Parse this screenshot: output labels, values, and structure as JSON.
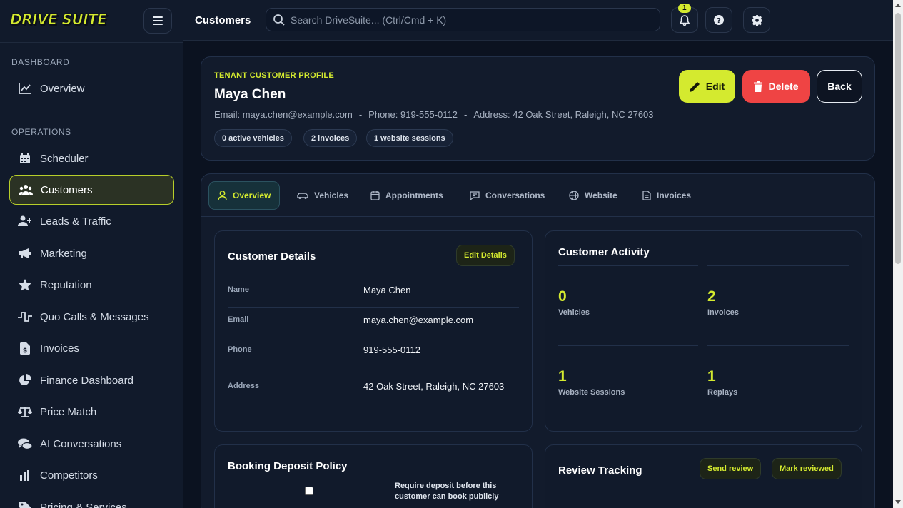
{
  "app": {
    "brand": "DRIVE SUITE"
  },
  "sidebar": {
    "sections": [
      {
        "label": "DASHBOARD"
      },
      {
        "label": "OPERATIONS"
      }
    ],
    "items": [
      {
        "label": "Overview",
        "icon": "chart-line-icon"
      },
      {
        "label": "Scheduler",
        "icon": "calendar-icon"
      },
      {
        "label": "Customers",
        "icon": "users-icon",
        "active": true
      },
      {
        "label": "Leads & Traffic",
        "icon": "user-plus-icon"
      },
      {
        "label": "Marketing",
        "icon": "megaphone-icon"
      },
      {
        "label": "Reputation",
        "icon": "star-icon"
      },
      {
        "label": "Quo Calls & Messages",
        "icon": "pulse-icon"
      },
      {
        "label": "Invoices",
        "icon": "invoice-icon"
      },
      {
        "label": "Finance Dashboard",
        "icon": "pie-chart-icon"
      },
      {
        "label": "Price Match",
        "icon": "scale-icon"
      },
      {
        "label": "AI Conversations",
        "icon": "chat-bubbles-icon"
      },
      {
        "label": "Competitors",
        "icon": "bar-chart-icon"
      },
      {
        "label": "Pricing & Services",
        "icon": "tag-icon"
      }
    ]
  },
  "topbar": {
    "title": "Customers",
    "search_placeholder": "Search DriveSuite... (Ctrl/Cmd + K)",
    "notification_count": "1"
  },
  "profile": {
    "eyebrow": "TENANT CUSTOMER PROFILE",
    "name": "Maya Chen",
    "email_text": "Email: maya.chen@example.com",
    "separator": "-",
    "phone_text": "Phone: 919-555-0112",
    "address_text": "Address: 42 Oak Street, Raleigh, NC 27603",
    "pills": [
      "0 active vehicles",
      "2 invoices",
      "1 website sessions"
    ],
    "edit_label": "Edit",
    "delete_label": "Delete",
    "back_label": "Back"
  },
  "tabs": [
    {
      "label": "Overview",
      "active": true
    },
    {
      "label": "Vehicles"
    },
    {
      "label": "Appointments"
    },
    {
      "label": "Conversations"
    },
    {
      "label": "Website"
    },
    {
      "label": "Invoices"
    }
  ],
  "customer_details": {
    "title": "Customer Details",
    "edit_label": "Edit Details",
    "rows": [
      {
        "label": "Name",
        "value": "Maya Chen"
      },
      {
        "label": "Email",
        "value": "maya.chen@example.com"
      },
      {
        "label": "Phone",
        "value": "919-555-0112"
      },
      {
        "label": "Address",
        "value": "42 Oak Street, Raleigh, NC 27603"
      }
    ]
  },
  "customer_activity": {
    "title": "Customer Activity",
    "stats": [
      {
        "value": "0",
        "label": "Vehicles"
      },
      {
        "value": "2",
        "label": "Invoices"
      },
      {
        "value": "1",
        "label": "Website Sessions"
      },
      {
        "value": "1",
        "label": "Replays"
      }
    ]
  },
  "booking_deposit": {
    "title": "Booking Deposit Policy",
    "checkbox_line1": "Require deposit before this",
    "checkbox_line2": "customer can book publicly",
    "checked": false
  },
  "review_tracking": {
    "title": "Review Tracking",
    "send_label": "Send review",
    "mark_label": "Mark reviewed"
  },
  "colors": {
    "accent": "#d4ea2f",
    "danger": "#ef4444",
    "background": "#0b1220",
    "panel": "#121b2c"
  }
}
